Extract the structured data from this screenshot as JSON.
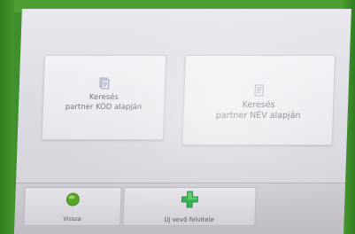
{
  "search": {
    "by_code_label": "Keresés partner KÓD alapján",
    "by_name_label": "Keresés partner NÉV alapján"
  },
  "footer": {
    "back_label": "Vissza",
    "new_customer_label": "Új vevő felvitele"
  },
  "colors": {
    "bezel": "#3f8f2c",
    "back_icon": "#5aa526",
    "plus_icon": "#2db34a"
  },
  "icons": {
    "by_code": "code-document-icon",
    "by_name": "name-document-icon",
    "back": "green-circle-icon",
    "new_customer": "green-plus-icon"
  }
}
